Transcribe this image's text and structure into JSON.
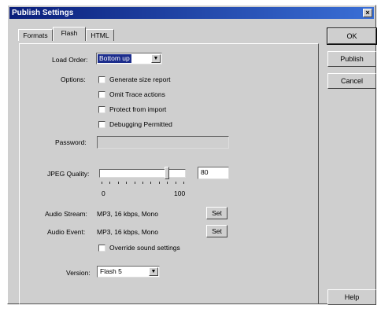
{
  "window": {
    "title": "Publish Settings"
  },
  "tabs": [
    {
      "label": "Formats"
    },
    {
      "label": "Flash"
    },
    {
      "label": "HTML"
    }
  ],
  "buttons": {
    "ok": "OK",
    "publish": "Publish",
    "cancel": "Cancel",
    "help": "Help"
  },
  "load_order": {
    "label": "Load Order:",
    "value": "Bottom up"
  },
  "options": {
    "label": "Options:",
    "items": [
      {
        "label": "Generate size report",
        "checked": false
      },
      {
        "label": "Omit Trace actions",
        "checked": false
      },
      {
        "label": "Protect from import",
        "checked": false
      },
      {
        "label": "Debugging Permitted",
        "checked": false
      }
    ]
  },
  "password": {
    "label": "Password:",
    "value": ""
  },
  "jpeg_quality": {
    "label": "JPEG Quality:",
    "value": "80",
    "min_label": "0",
    "max_label": "100",
    "level": 0.8
  },
  "audio_stream": {
    "label": "Audio Stream:",
    "value": "MP3, 16 kbps, Mono",
    "button": "Set"
  },
  "audio_event": {
    "label": "Audio Event:",
    "value": "MP3, 16 kbps, Mono",
    "button": "Set"
  },
  "override_sound": {
    "label": "Override sound settings",
    "checked": false
  },
  "version": {
    "label": "Version:",
    "value": "Flash 5"
  }
}
